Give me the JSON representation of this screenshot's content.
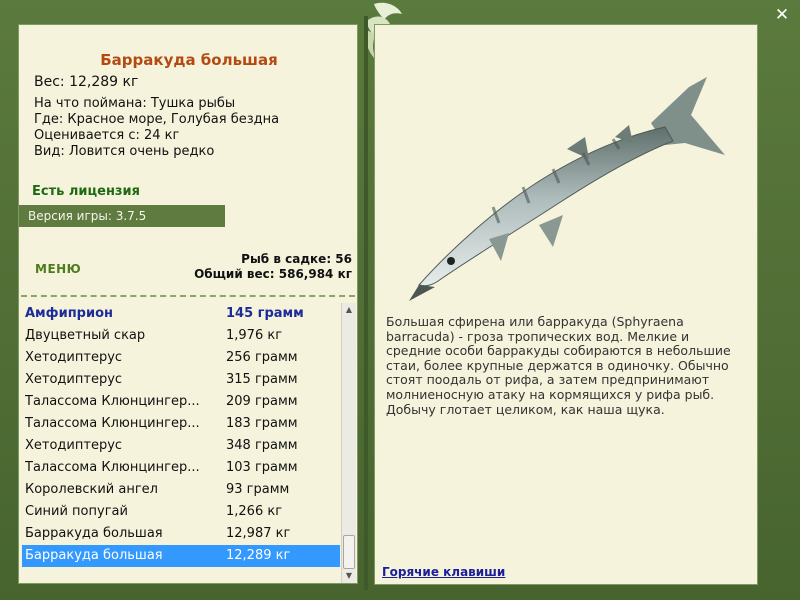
{
  "fish": {
    "name": "Барракуда большая",
    "weight": "Вес: 12,289 кг",
    "info": [
      "На что поймана: Тушка рыбы",
      "Где: Красное море, Голубая бездна",
      "Оценивается с: 24 кг",
      "Вид: Ловится очень редко"
    ],
    "description": "Большая сфирена или барракуда (Sphyraena barracuda) - гроза тропических вод. Мелкие и средние особи барракуды собираются в небольшие стаи, более крупные держатся в одиночку. Обычно стоят поодаль от рифа, а затем предпринимают молниеносную атаку на кормящихся у рифа рыб. Добычу глотает целиком, как наша щука."
  },
  "license": "Есть лицензия",
  "version": "Версия игры: 3.7.5",
  "menu_label": "МЕНЮ",
  "stats": {
    "fish_in_keepnet": "Рыб в садке: 56",
    "total_weight": "Общий вес: 586,984 кг"
  },
  "catch_list": [
    {
      "name": "Амфиприон",
      "weight": "145 грамм"
    },
    {
      "name": "Двуцветный скар",
      "weight": "1,976 кг"
    },
    {
      "name": "Хетодиптерус",
      "weight": "256 грамм"
    },
    {
      "name": "Хетодиптерус",
      "weight": "315 грамм"
    },
    {
      "name": "Талассома Клюнцингер...",
      "weight": "209 грамм"
    },
    {
      "name": "Талассома Клюнцингер...",
      "weight": "183 грамм"
    },
    {
      "name": "Хетодиптерус",
      "weight": "348 грамм"
    },
    {
      "name": "Талассома Клюнцингер...",
      "weight": "103 грамм"
    },
    {
      "name": "Королевский ангел",
      "weight": "93 грамм"
    },
    {
      "name": "Синий попугай",
      "weight": "1,266 кг"
    },
    {
      "name": "Барракуда большая",
      "weight": "12,987 кг"
    },
    {
      "name": "Барракуда большая",
      "weight": "12,289 кг"
    }
  ],
  "hotkeys_link": "Горячие клавиши",
  "icons": {
    "close": "close-icon",
    "logo": "leaf-logo-icon",
    "scroll_up": "chevron-up-icon",
    "scroll_down": "chevron-down-icon"
  },
  "colors": {
    "frame": "#4f6b36",
    "panel": "#f6f3dc",
    "fish_name": "#b34a12",
    "license": "#1e6a12",
    "selection": "#3399ff",
    "link": "#1a1f9a"
  }
}
